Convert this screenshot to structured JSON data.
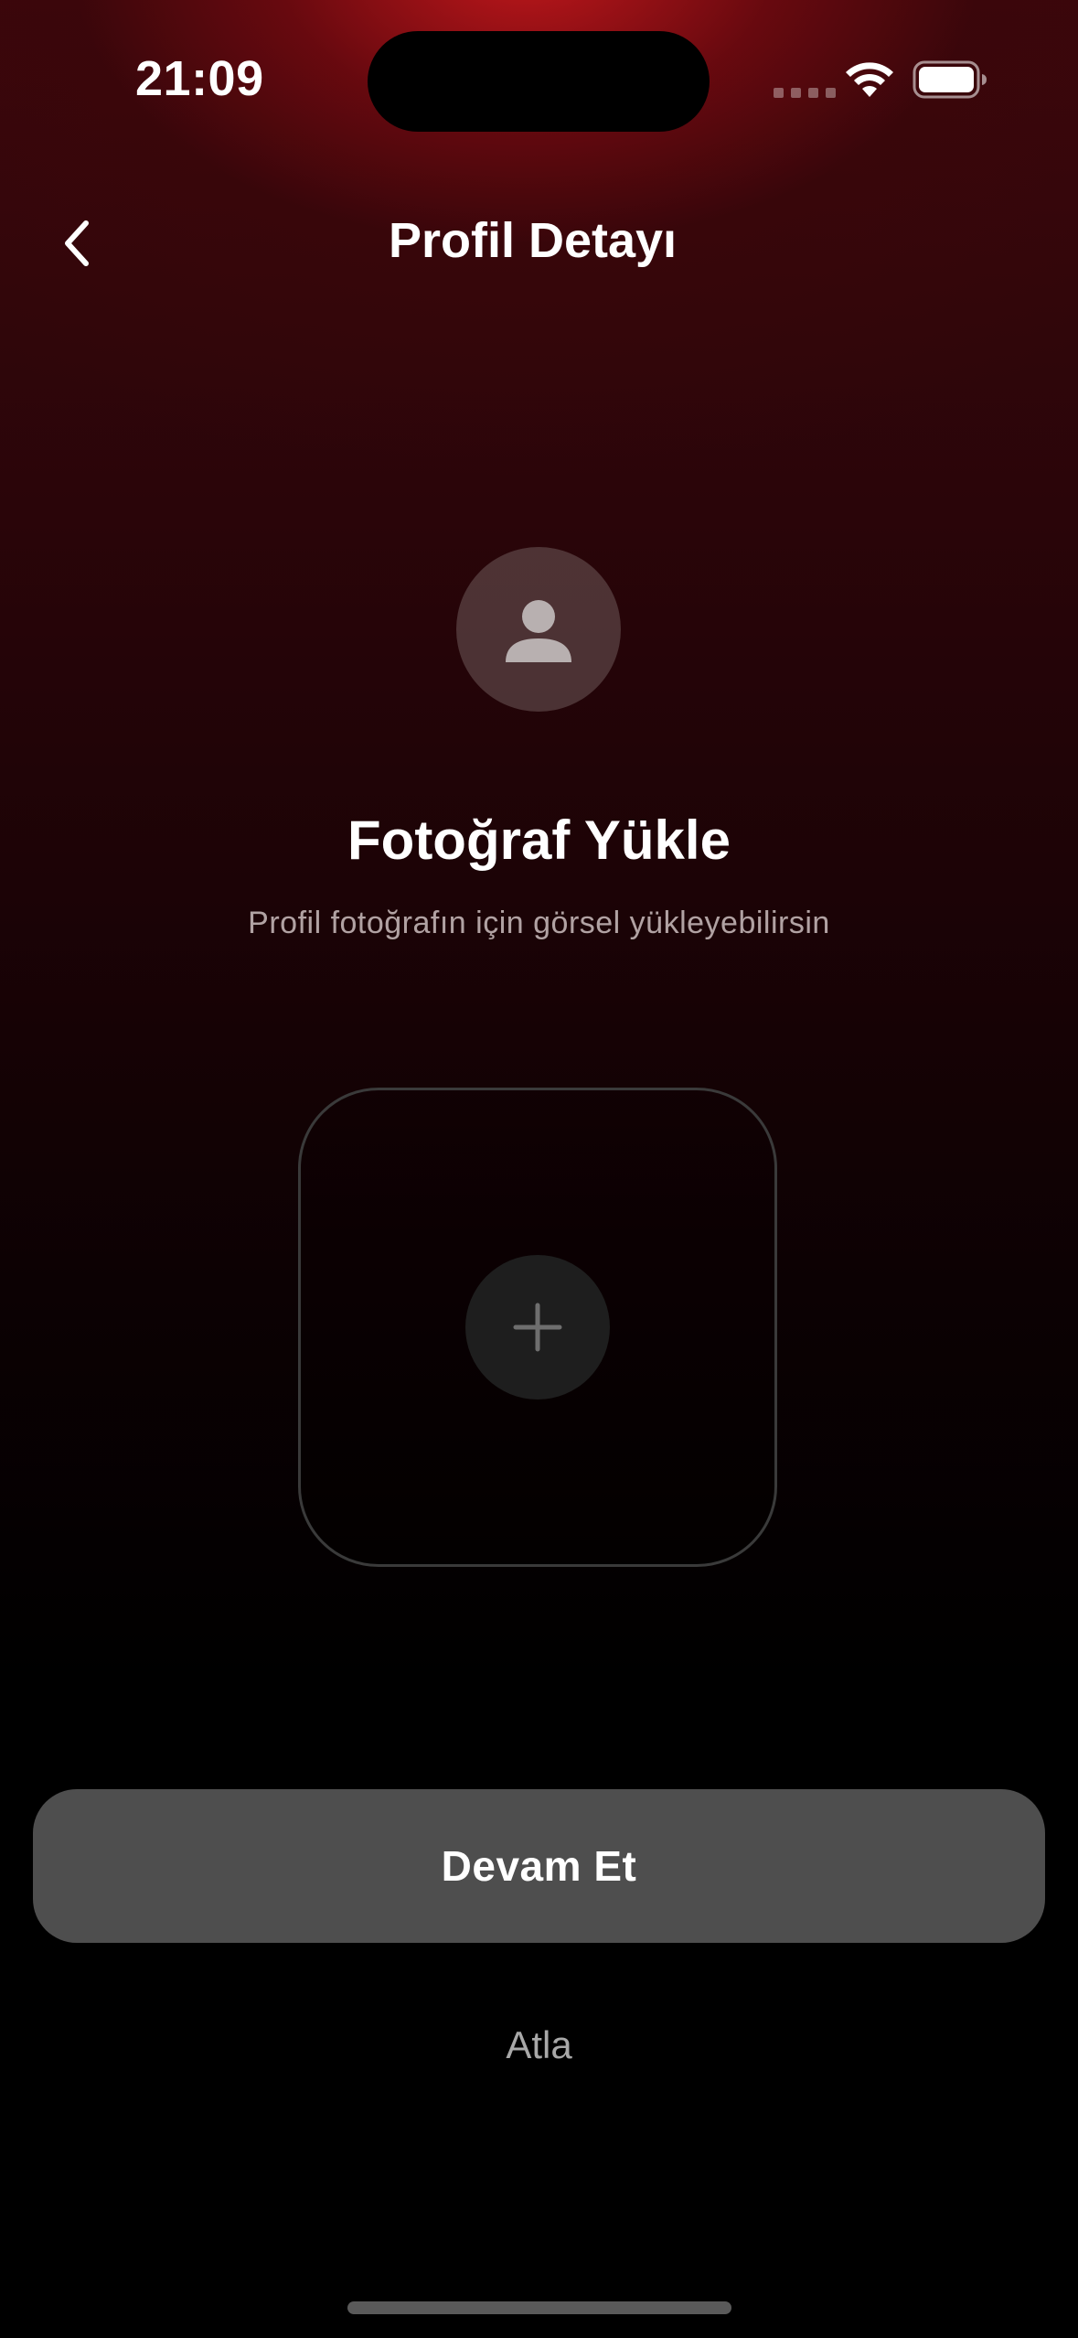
{
  "status_bar": {
    "time": "21:09",
    "icons": [
      "signal-dots-icon",
      "wifi-icon",
      "battery-icon"
    ]
  },
  "nav": {
    "title": "Profil Detayı",
    "back_icon": "chevron-left-icon"
  },
  "profile": {
    "avatar_icon": "person-icon",
    "heading": "Fotoğraf Yükle",
    "subheading": "Profil fotoğrafın için görsel yükleyebilirsin"
  },
  "upload": {
    "icon": "plus-icon"
  },
  "actions": {
    "continue_label": "Devam Et",
    "skip_label": "Atla"
  },
  "colors": {
    "accent_glow": "#c8181c",
    "background": "#000000",
    "button_bg": "#4e4e4e"
  }
}
